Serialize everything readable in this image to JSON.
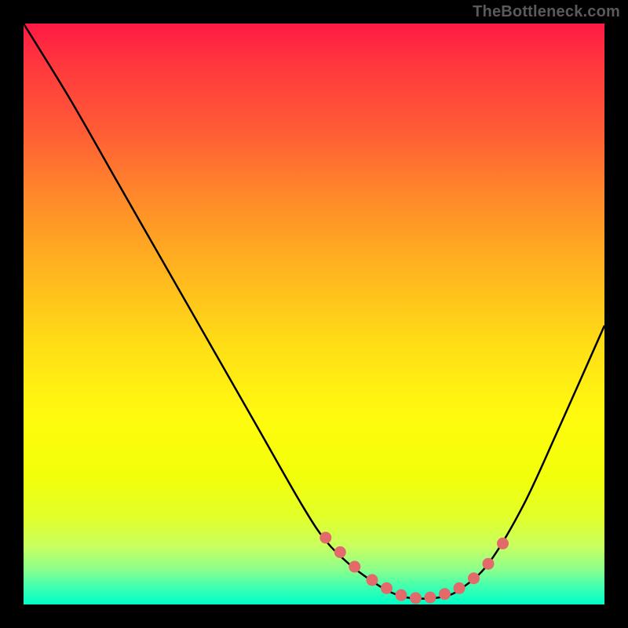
{
  "watermark": "TheBottleneck.com",
  "chart_data": {
    "type": "line",
    "title": "",
    "xlabel": "",
    "ylabel": "",
    "xlim": [
      0,
      100
    ],
    "ylim": [
      0,
      100
    ],
    "series": [
      {
        "name": "curve",
        "x": [
          0,
          8,
          16,
          24,
          32,
          40,
          48,
          52,
          56,
          60,
          63,
          66,
          69,
          72,
          75,
          80,
          86,
          92,
          100
        ],
        "y": [
          100,
          87,
          73,
          59,
          45,
          31,
          17,
          11,
          7,
          4,
          2.2,
          1.2,
          1.0,
          1.3,
          2.5,
          7,
          17,
          30,
          48
        ]
      }
    ],
    "markers": {
      "name": "dots",
      "x": [
        52,
        54.5,
        57,
        60,
        62.5,
        65,
        67.5,
        70,
        72.5,
        75,
        77.5,
        80,
        82.5
      ],
      "y": [
        11.5,
        9,
        6.5,
        4.2,
        2.8,
        1.6,
        1.1,
        1.2,
        1.8,
        2.8,
        4.5,
        7,
        10.5
      ]
    },
    "colors": {
      "curve": "#000000",
      "markers": "#e26a6a"
    }
  }
}
